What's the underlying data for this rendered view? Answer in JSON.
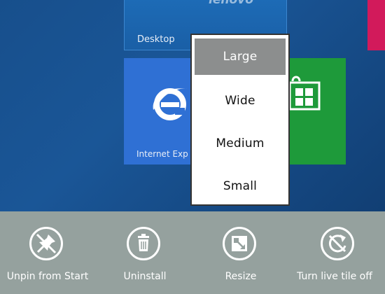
{
  "tiles": {
    "desktop": {
      "label": "Desktop",
      "brand": "lenovo"
    },
    "internet_explorer": {
      "label": "Internet Exp"
    }
  },
  "resize_menu": {
    "options": [
      "Large",
      "Wide",
      "Medium",
      "Small"
    ],
    "selected": "Large"
  },
  "app_bar": {
    "commands": [
      {
        "label": "Unpin from Start",
        "icon": "unpin-icon"
      },
      {
        "label": "Uninstall",
        "icon": "trash-icon"
      },
      {
        "label": "Resize",
        "icon": "resize-icon"
      },
      {
        "label": "Turn live tile off",
        "icon": "live-tile-icon"
      }
    ]
  },
  "colors": {
    "background": "#1a5697",
    "app_bar": "#95a19e",
    "ie_tile": "#2f70d4",
    "store_tile": "#1e9a3a",
    "pink_tile": "#d21a5b",
    "menu_selected": "#8c8e8e"
  }
}
